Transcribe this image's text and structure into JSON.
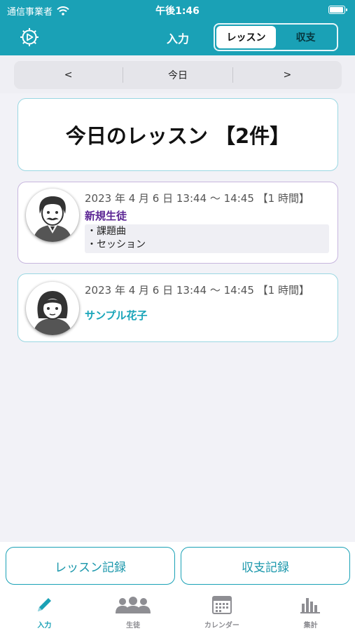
{
  "status": {
    "carrier": "通信事業者",
    "time": "午後1:46"
  },
  "nav": {
    "title": "入力",
    "segments": [
      "レッスン",
      "収支"
    ],
    "active_segment": "レッスン"
  },
  "date_nav": {
    "prev": "<",
    "current": "今日",
    "next": ">"
  },
  "header": {
    "title": "今日のレッスン 【2件】"
  },
  "lessons": [
    {
      "time": "2023 年 4 月 6 日 13:44 〜 14:45 【1 時間】",
      "student": "新規生徒",
      "topics": [
        "・課題曲",
        "・セッション"
      ],
      "avatar": "man-with-mustache-avatar",
      "name_color": "#5b2594"
    },
    {
      "time": "2023 年 4 月 6 日 13:44 〜 14:45 【1 時間】",
      "student": "サンプル花子",
      "topics": [],
      "avatar": "woman-avatar",
      "name_color": "#19a5b9"
    }
  ],
  "actions": {
    "lesson_record": "レッスン記録",
    "income_record": "収支記録"
  },
  "tabs": [
    {
      "label": "入力",
      "icon": "pencil-icon",
      "active": true
    },
    {
      "label": "生徒",
      "icon": "people-icon",
      "active": false
    },
    {
      "label": "カレンダー",
      "icon": "calendar-icon",
      "active": false
    },
    {
      "label": "集計",
      "icon": "bar-chart-icon",
      "active": false
    }
  ],
  "colors": {
    "accent": "#1aa1b6",
    "background": "#efeff4",
    "card_border": "#9ad7e2",
    "purple": "#5b2594"
  }
}
